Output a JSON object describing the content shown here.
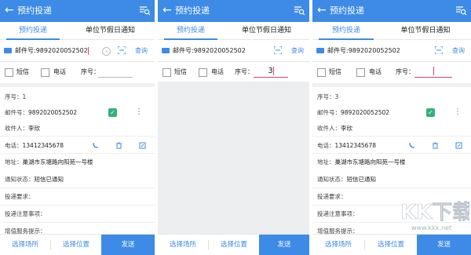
{
  "app": {
    "title": "预约投递",
    "back_glyph": "←"
  },
  "tabs": [
    "预约投递",
    "单位节假日通知"
  ],
  "search": {
    "value_typed": "邮件号:9892020052502",
    "value_plain": "邮件号:9892020052502",
    "button": "查询",
    "clear_glyph": "×"
  },
  "filters": {
    "sms": "短信",
    "phone": "电话",
    "seq_label": "序号："
  },
  "screens": [
    {
      "seq_value": ""
    },
    {
      "seq_value": "3"
    },
    {
      "seq_value": ""
    }
  ],
  "detail1": {
    "seq": "序号：1",
    "mail_label": "邮件号：",
    "mail_no": "9892020052502",
    "receiver_label": "收件人：",
    "receiver": "李欣",
    "phone_label": "电话：",
    "phone": "13412345678",
    "address_label": "地址：",
    "address": "巢湖市东塘路向阳苑一号楼",
    "notify_label": "通知状态：",
    "notify": "短信已通知",
    "req": "投递要求：",
    "note": "投递注意事项：",
    "extra": "增值服务提示："
  },
  "detail3": {
    "seq": "序号：3",
    "mail_label": "邮件号：",
    "mail_no": "9892020052502",
    "receiver_label": "收件人：",
    "receiver": "李欣",
    "phone_label": "电话：",
    "phone": "13412345678",
    "address_label": "地址：",
    "address": "巢湖市东塘路向阳苑一号楼",
    "notify_label": "通知状态：",
    "notify": "短信已通知",
    "req": "投递要求：",
    "note": "投递注意事项：",
    "extra": "增值服务提示："
  },
  "bottom": {
    "select_site": "选择场所",
    "select_pos": "选择位置",
    "send": "发送"
  },
  "watermark": {
    "text": "KK下载",
    "url": "www.kkx.net"
  },
  "colors": {
    "primary": "#3d8be6",
    "check": "#2fb37b",
    "accent_line": "#e04070",
    "empty_bg": "#eceef0"
  }
}
